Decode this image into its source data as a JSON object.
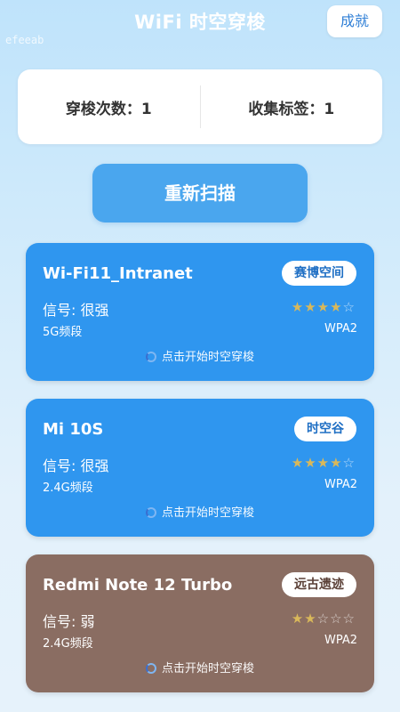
{
  "header": {
    "title": "WiFi 时空穿梭",
    "achievements_label": "成就",
    "watermark": "efeeab"
  },
  "stats": {
    "travels": "穿梭次数：1",
    "tags": "收集标签：1"
  },
  "rescan_label": "重新扫描",
  "colors": {
    "card_blue": "#2f96ef",
    "card_brown": "#8a6d62",
    "button_blue": "#4aa6ee",
    "star_gold": "#d9b85a"
  },
  "cards": [
    {
      "name": "Wi-Fi11_Intranet",
      "tag": "赛博空间",
      "signal": "信号: 很强",
      "stars": 4,
      "stars_max": 5,
      "band": "5G频段",
      "security": "WPA2",
      "hint": "点击开始时空穿梭"
    },
    {
      "name": "Mi 10S",
      "tag": "时空谷",
      "signal": "信号: 很强",
      "stars": 4,
      "stars_max": 5,
      "band": "2.4G频段",
      "security": "WPA2",
      "hint": "点击开始时空穿梭"
    },
    {
      "name": "Redmi Note 12 Turbo",
      "tag": "远古遗迹",
      "signal": "信号: 弱",
      "stars": 2,
      "stars_max": 5,
      "band": "2.4G频段",
      "security": "WPA2",
      "hint": "点击开始时空穿梭"
    }
  ]
}
